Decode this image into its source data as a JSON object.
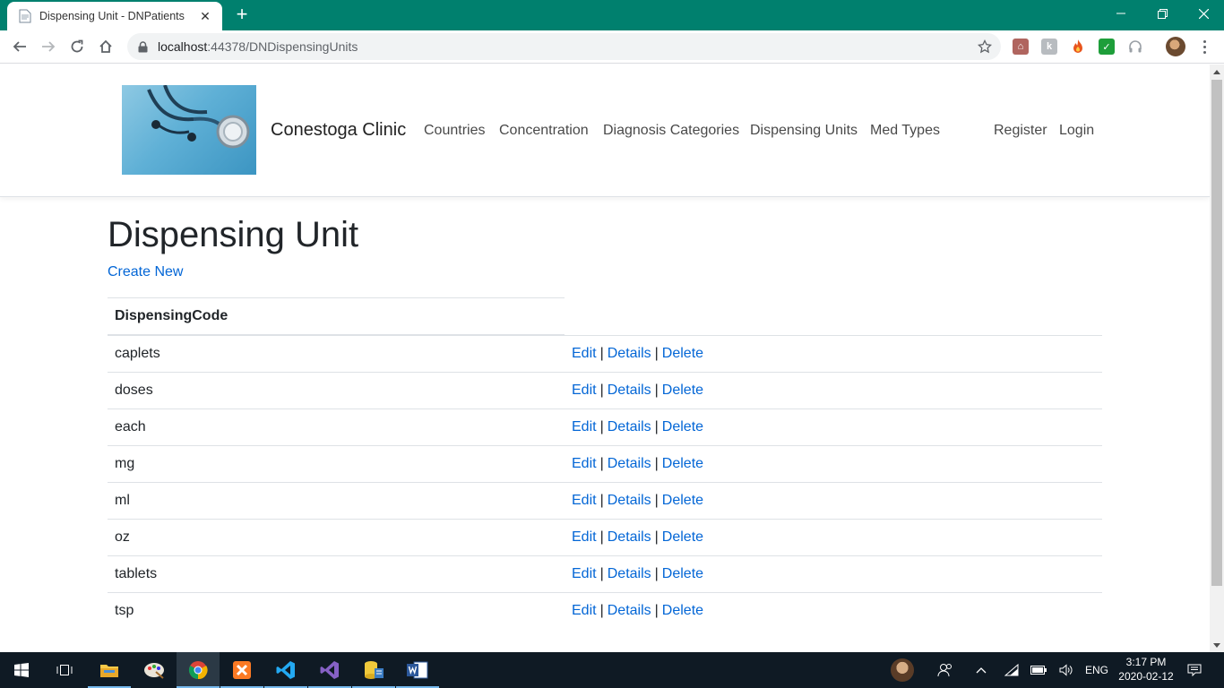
{
  "browser": {
    "tab_title": "Dispensing Unit - DNPatients",
    "url_host": "localhost",
    "url_path": ":44378/DNDispensingUnits"
  },
  "site": {
    "brand": "Conestoga Clinic",
    "nav": [
      "Countries",
      "Concentration",
      "Diagnosis Categories",
      "Dispensing Units",
      "Med Types"
    ],
    "account": [
      "Register",
      "Login"
    ]
  },
  "page": {
    "title": "Dispensing Unit",
    "create_link": "Create New",
    "column_header": "DispensingCode",
    "action_labels": {
      "edit": "Edit",
      "details": "Details",
      "delete": "Delete",
      "separator": "|"
    },
    "rows": [
      "caplets",
      "doses",
      "each",
      "mg",
      "ml",
      "oz",
      "tablets",
      "tsp"
    ]
  },
  "taskbar": {
    "lang": "ENG",
    "time": "3:17 PM",
    "date": "2020-02-12"
  },
  "colors": {
    "chrome_frame": "#00806e",
    "link": "#0366d6",
    "taskbar": "#0f1a24"
  }
}
